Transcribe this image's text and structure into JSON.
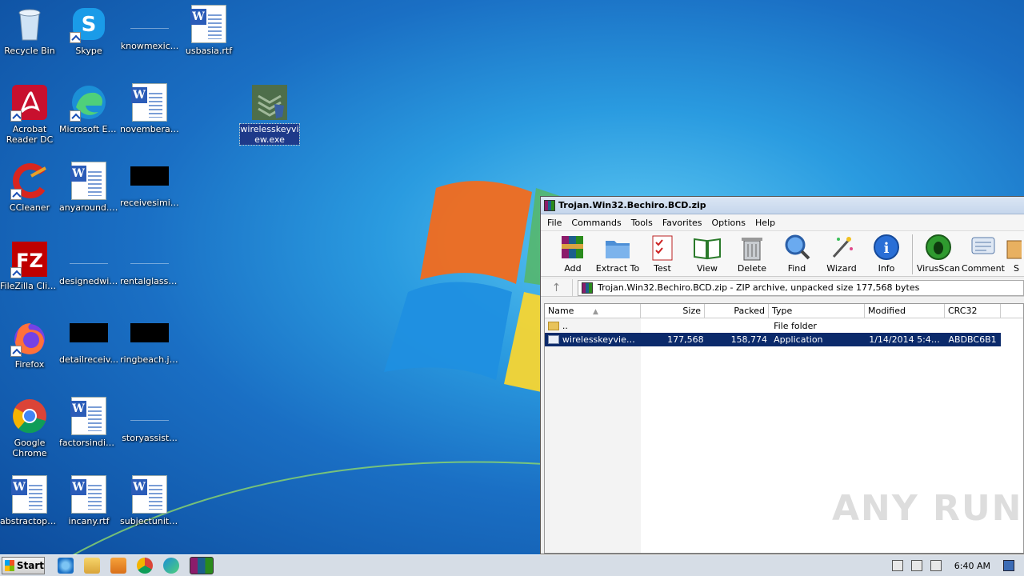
{
  "desktop": {
    "icons": [
      {
        "label": "Recycle Bin"
      },
      {
        "label": "Skype"
      },
      {
        "label": "knowmexic..."
      },
      {
        "label": "usbasia.rtf"
      },
      {
        "label": "Acrobat Reader DC"
      },
      {
        "label": "Microsoft Edge"
      },
      {
        "label": "novemberal..."
      },
      {
        "label": "wirelesskeyview.exe"
      },
      {
        "label": "CCleaner"
      },
      {
        "label": "anyaround.rtf"
      },
      {
        "label": "receivesimil..."
      },
      {
        "label": "FileZilla Client"
      },
      {
        "label": "designedwil..."
      },
      {
        "label": "rentalglass...."
      },
      {
        "label": "Firefox"
      },
      {
        "label": "detailreceiv..."
      },
      {
        "label": "ringbeach.jpg"
      },
      {
        "label": "Google Chrome"
      },
      {
        "label": "factorsindia..."
      },
      {
        "label": "storyassist..."
      },
      {
        "label": "abstractopti..."
      },
      {
        "label": "incany.rtf"
      },
      {
        "label": "subjectunit.rtf"
      }
    ]
  },
  "winrar": {
    "title": "Trojan.Win32.Bechiro.BCD.zip",
    "menu": [
      "File",
      "Commands",
      "Tools",
      "Favorites",
      "Options",
      "Help"
    ],
    "toolbar": [
      "Add",
      "Extract To",
      "Test",
      "View",
      "Delete",
      "Find",
      "Wizard",
      "Info",
      "VirusScan",
      "Comment",
      "S"
    ],
    "address": "Trojan.Win32.Bechiro.BCD.zip - ZIP archive, unpacked size 177,568 bytes",
    "columns": [
      "Name",
      "Size",
      "Packed",
      "Type",
      "Modified",
      "CRC32"
    ],
    "rows": [
      {
        "name": "..",
        "size": "",
        "packed": "",
        "type": "File folder",
        "modified": "",
        "crc": ""
      },
      {
        "name": "wirelesskeyview....",
        "size": "177,568",
        "packed": "158,774",
        "type": "Application",
        "modified": "1/14/2014 5:40...",
        "crc": "ABDBC6B1"
      }
    ]
  },
  "watermark": "ANY RUN",
  "taskbar": {
    "start_label": "Start",
    "clock": "6:40 AM"
  }
}
